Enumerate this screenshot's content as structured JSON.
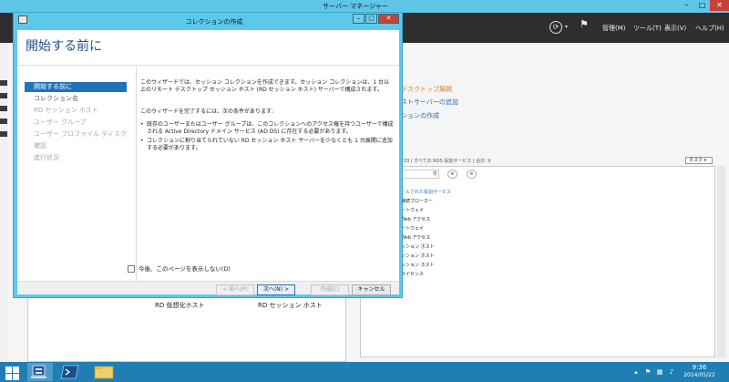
{
  "server_manager": {
    "title": "サーバー マネージャー",
    "window_controls": {
      "minimize": "–",
      "maximize": "□",
      "close": "✕"
    },
    "toolbar": {
      "refresh": "⟳",
      "menus": [
        "管理(M)",
        "ツール(T)",
        "表示(V)",
        "ヘルプ(H)"
      ]
    },
    "quick_links": [
      "デスクトップ展開",
      "ストサーバーの追加",
      "ションの作成"
    ],
    "servers_header": "8:23:33 | すべての RDS 役割サービス | 合計: 9",
    "task_dropdown": "タスク ▾",
    "role_list": [
      "ールされた役割サービス",
      "接続ブローカー",
      "ートウェイ",
      "Web アクセス",
      "ートウェイ",
      "Web アクセス",
      "ッション ホスト",
      "ッション ホスト",
      "ッション ホスト",
      "ライセンス"
    ],
    "bottom_labels": {
      "virtualization_host": "RD 仮想化ホスト",
      "session_host": "RD セッション ホスト"
    }
  },
  "taskbar": {
    "clock_time": "9:36",
    "clock_date": "2014/05/22"
  },
  "wizard": {
    "title": "コレクションの作成",
    "window_controls": {
      "minimize": "–",
      "maximize": "□",
      "close": "✕"
    },
    "heading": "開始する前に",
    "steps": [
      {
        "label": "開始する前に",
        "state": "active"
      },
      {
        "label": "コレクション名",
        "state": "enabled"
      },
      {
        "label": "RD セッション ホスト",
        "state": "disabled"
      },
      {
        "label": "ユーザー グループ",
        "state": "disabled"
      },
      {
        "label": "ユーザー プロファイル ディスク",
        "state": "disabled"
      },
      {
        "label": "確認",
        "state": "disabled"
      },
      {
        "label": "進行状況",
        "state": "disabled"
      }
    ],
    "intro": "このウィザードでは、セッション コレクションを作成できます。セッション コレクションは、1 台以上のリモート デスクトップ セッション ホスト (RD セッション ホスト) サーバーで構成されます。",
    "requirements_intro": "このウィザードを完了するには、次の条件があります:",
    "requirements": [
      "既存のユーザーまたはユーザー グループは、このコレクションへのアクセス権を持つユーザーで構成される Active Directory ドメイン サービス (AD DS) に存在する必要があります。",
      "コレクションに割り当てられていない RD セッション ホスト サーバーを少なくとも 1 台展開に追加する必要があります。"
    ],
    "dont_show_label": "今後、このページを表示しない(D)",
    "buttons": {
      "prev": "< 前へ(P)",
      "next": "次へ(N) >",
      "create": "作成(C)",
      "cancel": "キャンセル"
    }
  }
}
